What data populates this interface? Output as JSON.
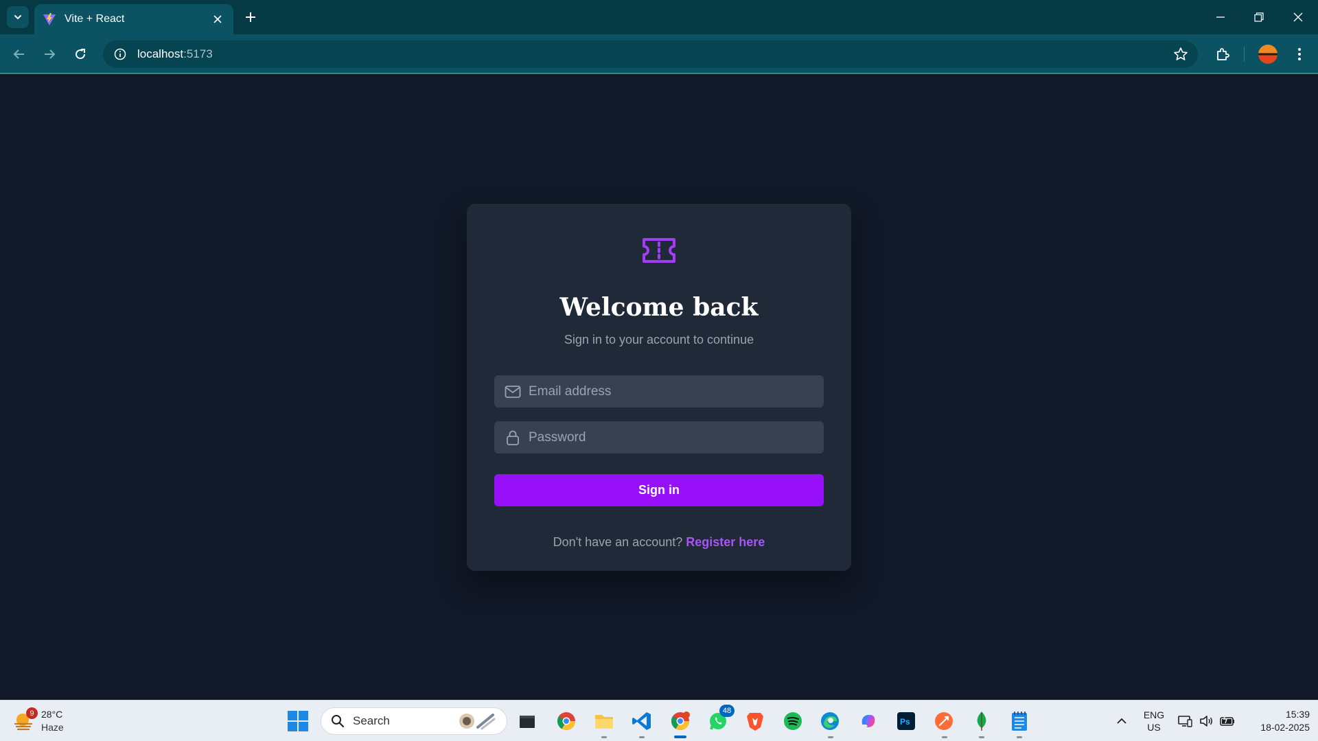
{
  "browser": {
    "tab_title": "Vite + React",
    "url_host": "localhost",
    "url_port": ":5173",
    "icons": [
      "tab-search-icon",
      "vite-favicon",
      "close-icon",
      "plus-icon",
      "minimize-icon",
      "restore-icon",
      "window-close-icon",
      "back-icon",
      "forward-icon",
      "reload-icon",
      "info-icon",
      "star-icon",
      "extensions-icon",
      "profile-avatar",
      "kebab-menu-icon"
    ]
  },
  "login": {
    "logo_icon": "ticket-icon",
    "title": "Welcome back",
    "subtitle": "Sign in to your account to continue",
    "email_placeholder": "Email address",
    "email_icon": "mail-icon",
    "password_placeholder": "Password",
    "password_icon": "lock-icon",
    "submit_label": "Sign in",
    "footer_text": "Don't have an account?",
    "register_link": "Register here",
    "accent_color": "#9810fa"
  },
  "taskbar": {
    "weather_temp": "28°C",
    "weather_condition": "Haze",
    "weather_badge": "9",
    "search_label": "Search",
    "whatsapp_badge": "48",
    "lang_primary": "ENG",
    "lang_secondary": "US",
    "time": "15:39",
    "date": "18-02-2025",
    "apps": [
      "windows-start-icon",
      "file-explorer-app-icon",
      "chrome-app-icon",
      "folder-app-icon",
      "vscode-app-icon",
      "chrome-profile-app-icon",
      "whatsapp-app-icon",
      "brave-app-icon",
      "spotify-app-icon",
      "edge-app-icon",
      "copilot-app-icon",
      "photoshop-app-icon",
      "postman-app-icon",
      "mongodb-app-icon",
      "notepad-app-icon"
    ]
  }
}
